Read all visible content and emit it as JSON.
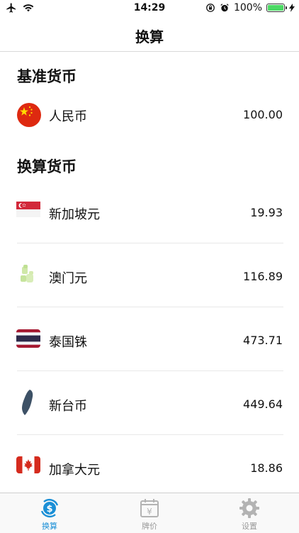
{
  "status_bar": {
    "time": "14:29",
    "battery": "100%"
  },
  "nav": {
    "title": "换算"
  },
  "base_section": {
    "title": "基准货币",
    "item": {
      "name": "人民币",
      "value": "100.00",
      "flag_icon": "china-flag-icon"
    }
  },
  "convert_section": {
    "title": "换算货币",
    "items": [
      {
        "name": "新加坡元",
        "value": "19.93",
        "flag_icon": "singapore-flag-icon"
      },
      {
        "name": "澳门元",
        "value": "116.89",
        "flag_icon": "macau-flag-icon"
      },
      {
        "name": "泰国铢",
        "value": "473.71",
        "flag_icon": "thailand-flag-icon"
      },
      {
        "name": "新台币",
        "value": "449.64",
        "flag_icon": "taiwan-map-icon"
      },
      {
        "name": "加拿大元",
        "value": "18.86",
        "flag_icon": "canada-flag-icon"
      }
    ]
  },
  "tabs": [
    {
      "label": "换算",
      "icon": "currency-exchange-icon",
      "active": true
    },
    {
      "label": "牌价",
      "icon": "calendar-yen-icon",
      "active": false
    },
    {
      "label": "设置",
      "icon": "gear-icon",
      "active": false
    }
  ],
  "colors": {
    "accent": "#1a8fd6",
    "inactive": "#b3b3b3",
    "battery": "#4cd964"
  }
}
